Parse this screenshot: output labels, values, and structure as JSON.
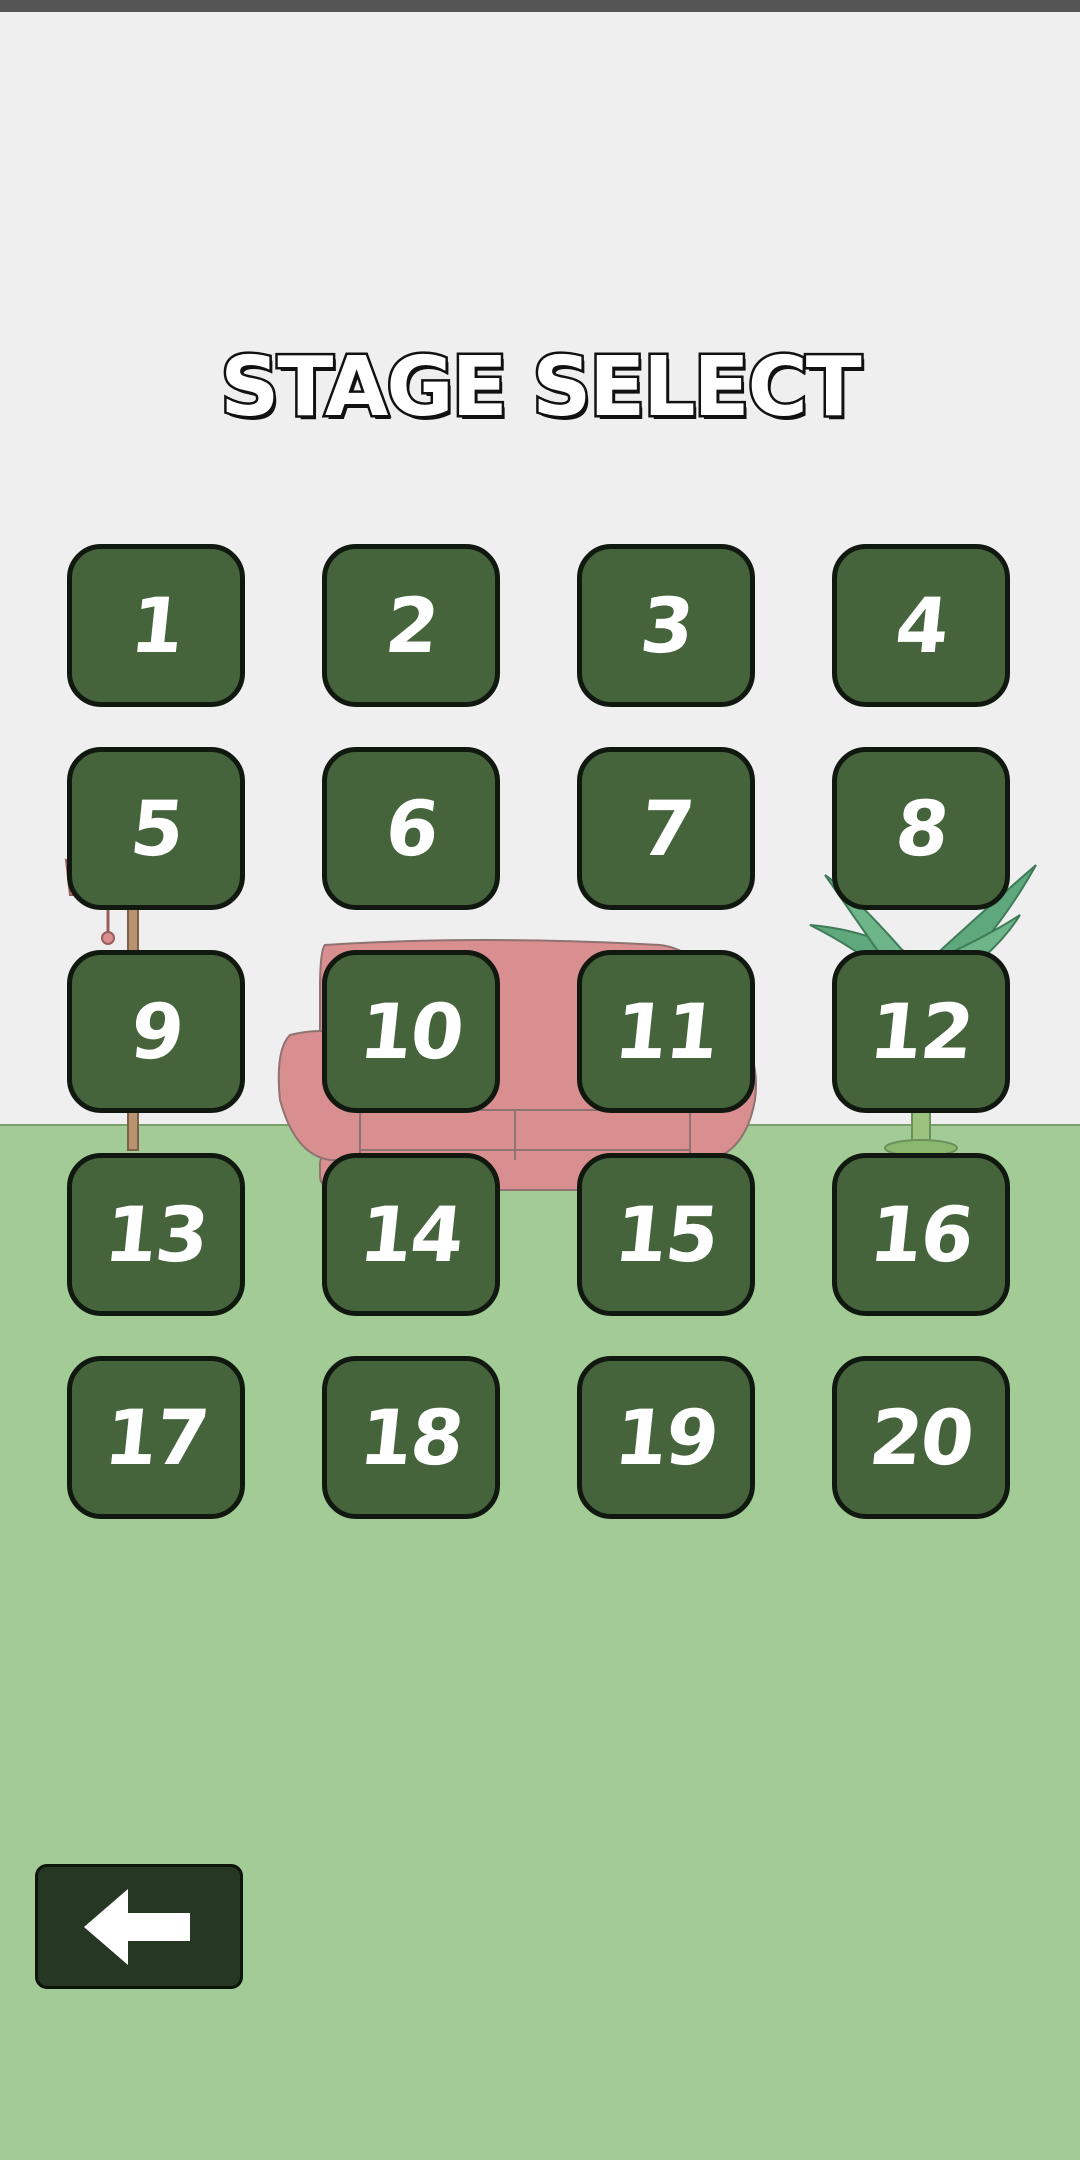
{
  "title": "STAGE SELECT",
  "stages": [
    {
      "label": "1"
    },
    {
      "label": "2"
    },
    {
      "label": "3"
    },
    {
      "label": "4"
    },
    {
      "label": "5"
    },
    {
      "label": "6"
    },
    {
      "label": "7"
    },
    {
      "label": "8"
    },
    {
      "label": "9"
    },
    {
      "label": "10"
    },
    {
      "label": "11"
    },
    {
      "label": "12"
    },
    {
      "label": "13"
    },
    {
      "label": "14"
    },
    {
      "label": "15"
    },
    {
      "label": "16"
    },
    {
      "label": "17"
    },
    {
      "label": "18"
    },
    {
      "label": "19"
    },
    {
      "label": "20"
    }
  ],
  "back_button": {
    "icon": "arrow-left-icon"
  },
  "colors": {
    "wall": "#efefef",
    "floor": "#a3cb95",
    "button": "#46643c",
    "button_border": "#101810",
    "back_button": "#263823",
    "sofa": "#d98f8f",
    "plant_leaf": "#5fa77c"
  }
}
